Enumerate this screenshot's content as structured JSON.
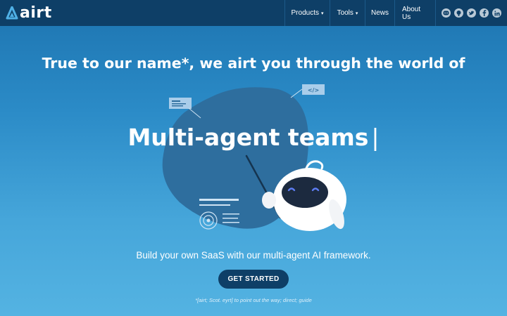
{
  "nav": {
    "brand": "airt",
    "items": [
      {
        "label": "Products",
        "has_dropdown": true
      },
      {
        "label": "Tools",
        "has_dropdown": true
      },
      {
        "label": "News",
        "has_dropdown": false
      },
      {
        "label": "About Us",
        "has_dropdown": false
      }
    ],
    "socials": [
      "discord-icon",
      "github-icon",
      "twitter-icon",
      "facebook-icon",
      "linkedin-icon"
    ],
    "caret": "▾"
  },
  "hero": {
    "headline": "True to our name*, we airt you through the world of",
    "typed_text": "Multi-agent teams",
    "cursor": "|",
    "subtitle": "Build your own SaaS with our multi-agent AI framework.",
    "cta_label": "GET STARTED",
    "footnote": "*[airt; Scot. eyrt] to point out the way; direct; guide",
    "code_badge": "</>"
  },
  "colors": {
    "navbar": "#0e3f67",
    "gradient_top": "#1d74b0",
    "gradient_bottom": "#54b3e2",
    "blob": "#2e6e9e",
    "button": "#0e3f67"
  }
}
